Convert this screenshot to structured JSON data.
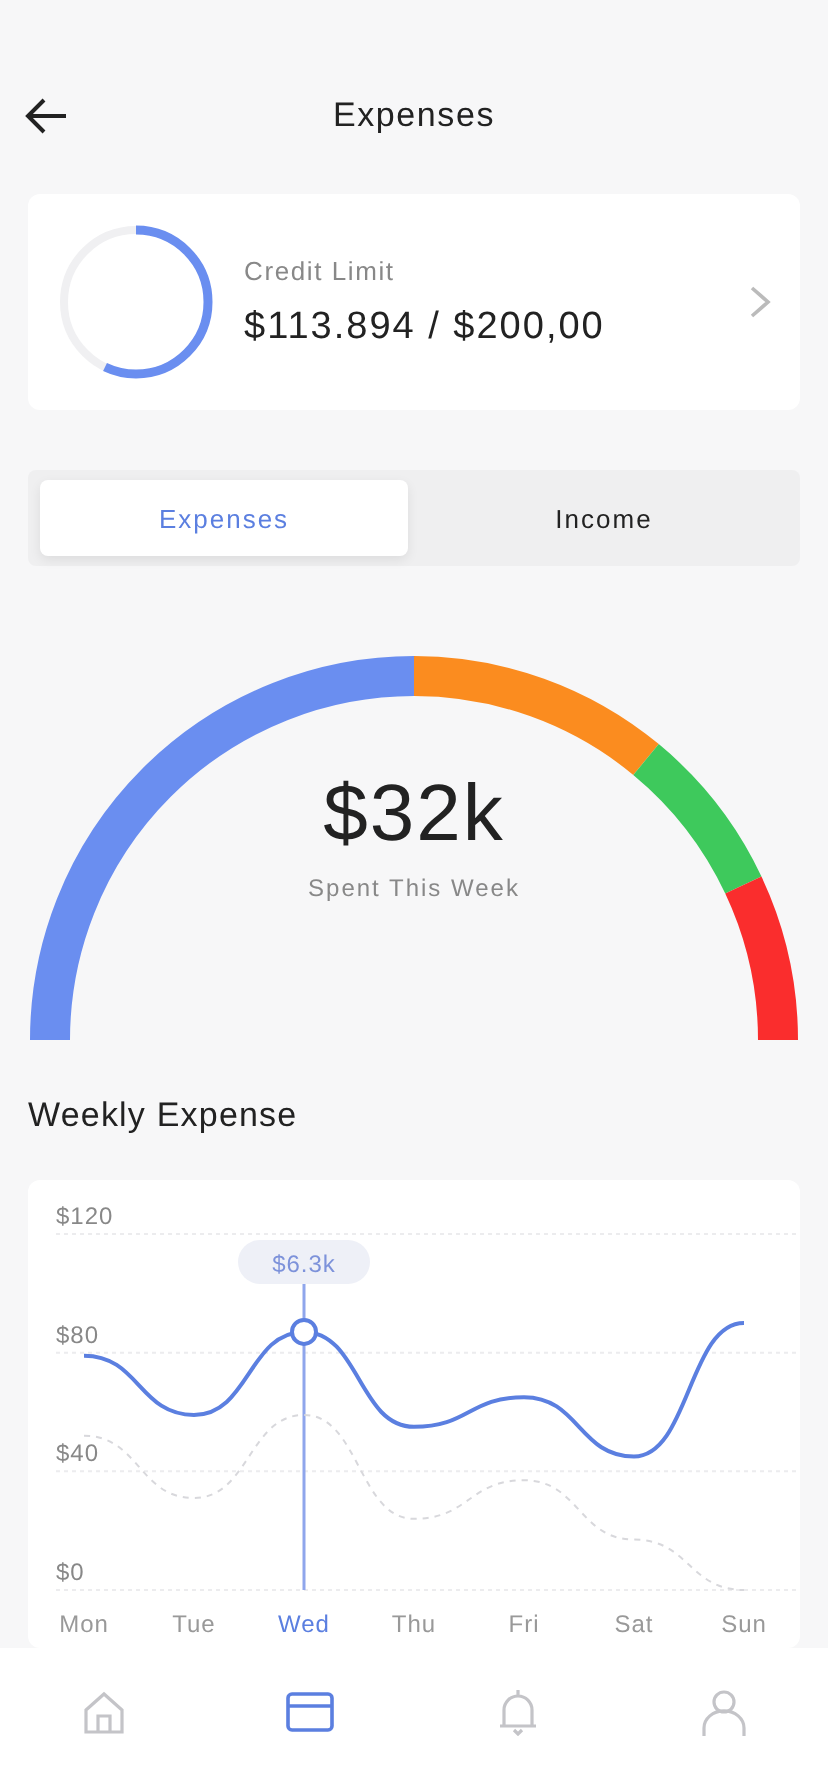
{
  "header": {
    "title": "Expenses"
  },
  "credit_card": {
    "label": "Credit Limit",
    "amount": "$113.894 / $200,00",
    "level": 0.57
  },
  "tabs": [
    {
      "label": "Expenses",
      "selected": true
    },
    {
      "label": "Income",
      "selected": false
    }
  ],
  "gauge": {
    "value": "$32k",
    "caption": "Spent This Week",
    "segments": [
      {
        "color": "#6a8ef0"
      },
      {
        "color": "#fb8c1f"
      },
      {
        "color": "#3ec95c"
      },
      {
        "color": "#fa2d2d"
      }
    ]
  },
  "weekly": {
    "title": "Weekly Expense",
    "chart_data": {
      "type": "line",
      "categories": [
        "Mon",
        "Tue",
        "Wed",
        "Thu",
        "Fri",
        "Sat",
        "Sun"
      ],
      "series": [
        {
          "color": "#5b7fe0",
          "line_style": "solid",
          "values": [
            79,
            59,
            87,
            55,
            65,
            45,
            90
          ]
        },
        {
          "color": "#d8d8dc",
          "line_style": "dashed",
          "values": [
            52,
            31,
            59,
            24,
            37,
            17,
            0
          ]
        }
      ],
      "ylim": [
        0,
        120
      ],
      "yticks": [
        {
          "value": 0,
          "label": "$0"
        },
        {
          "value": 40,
          "label": "$40"
        },
        {
          "value": 80,
          "label": "$80"
        },
        {
          "value": 120,
          "label": "$120"
        }
      ],
      "annotations": [
        {
          "x": "Wed",
          "y": 87,
          "text": "$6.3k"
        }
      ],
      "ref_lines": [
        {
          "axis": "x",
          "value": "Wed",
          "color": "#8fa6ec"
        }
      ]
    }
  },
  "nav": [
    {
      "kind": "home",
      "selected": false
    },
    {
      "kind": "card",
      "selected": true
    },
    {
      "kind": "bell",
      "selected": false
    },
    {
      "kind": "user",
      "selected": false
    }
  ]
}
